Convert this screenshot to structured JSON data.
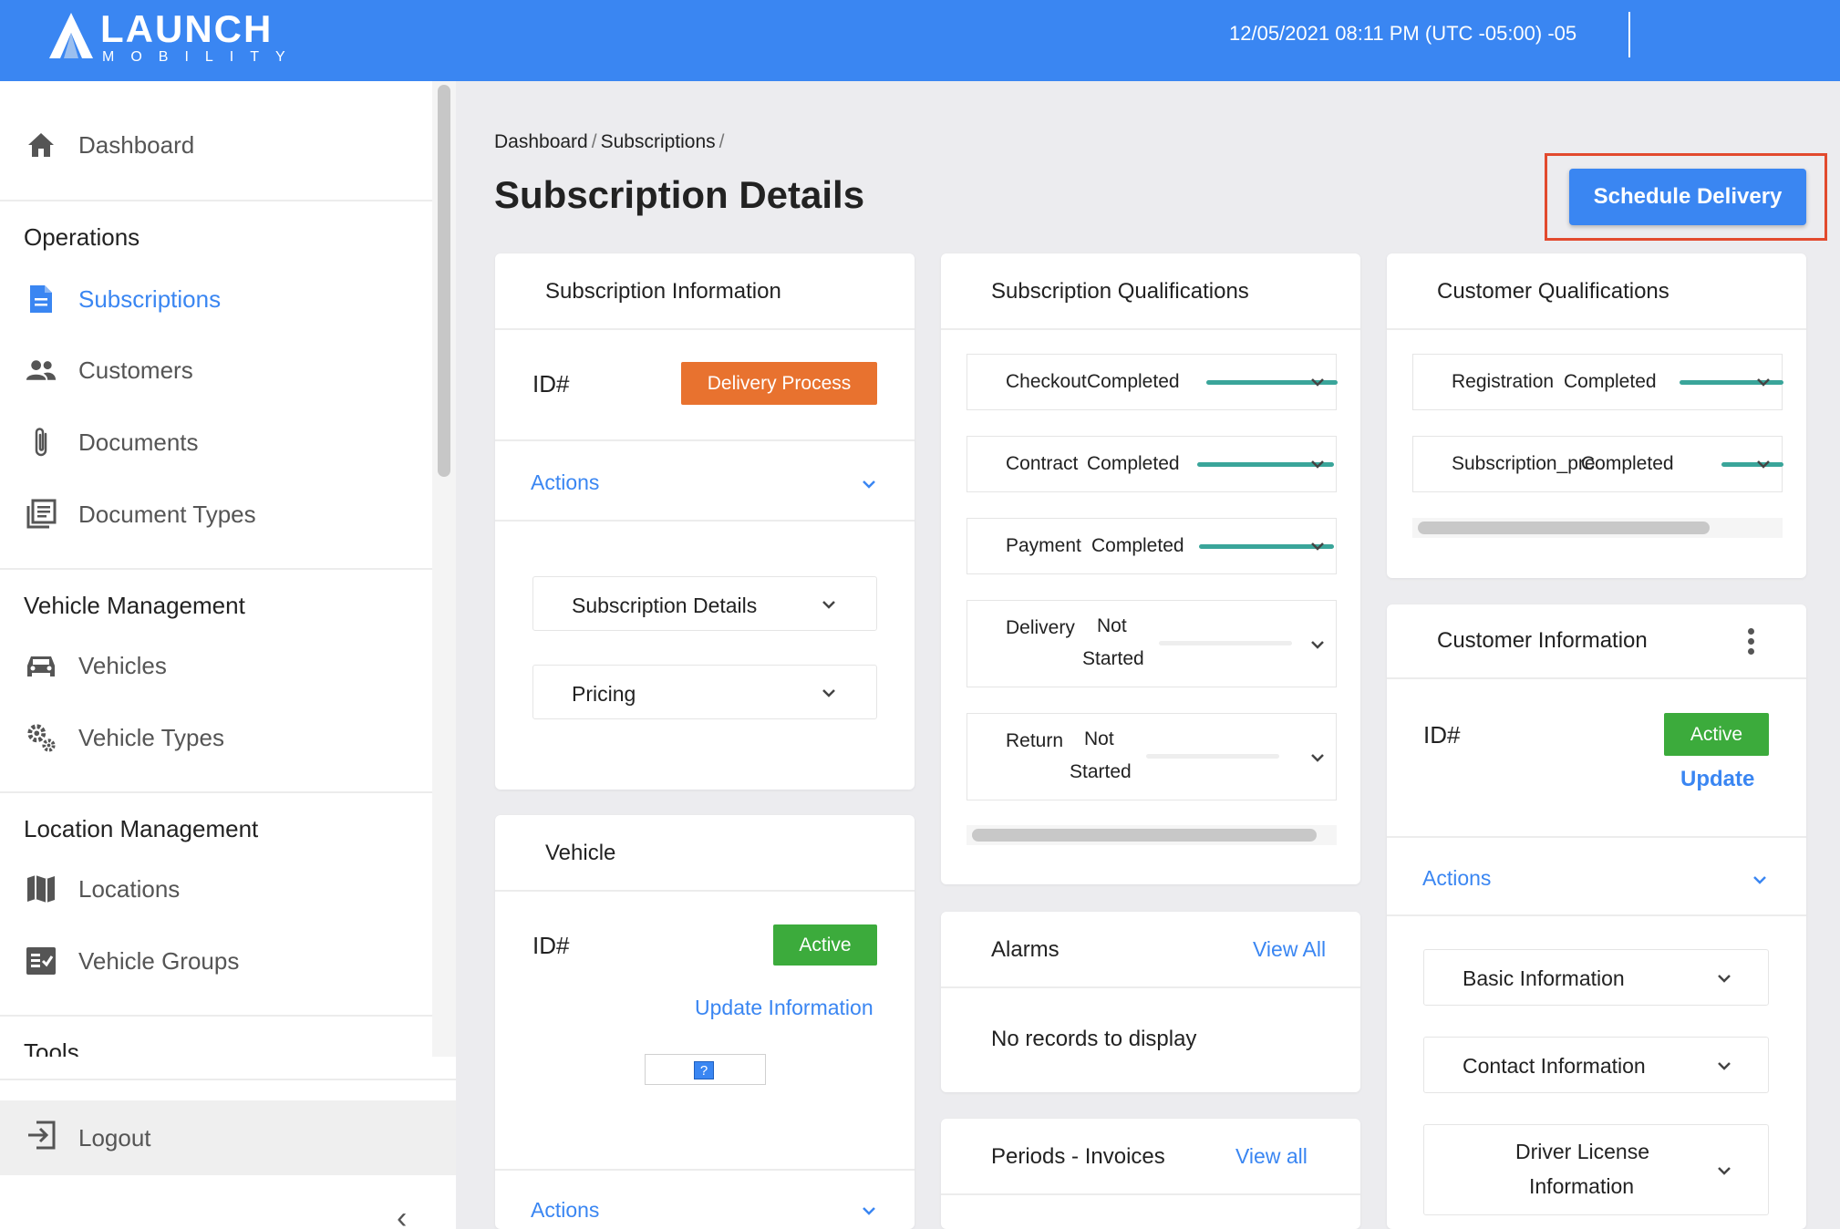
{
  "header": {
    "logo_word": "LAUNCH",
    "logo_sub": "MOBILITY",
    "datetime": "12/05/2021 08:11 PM (UTC -05:00) -05"
  },
  "sidebar": {
    "dashboard": "Dashboard",
    "sections": {
      "operations": "Operations",
      "vehicle_management": "Vehicle Management",
      "location_management": "Location Management",
      "tools": "Tools"
    },
    "items": {
      "subscriptions": "Subscriptions",
      "customers": "Customers",
      "documents": "Documents",
      "document_types": "Document Types",
      "vehicles": "Vehicles",
      "vehicle_types": "Vehicle Types",
      "locations": "Locations",
      "vehicle_groups": "Vehicle Groups"
    },
    "logout": "Logout",
    "active_color": "#3a86f2"
  },
  "breadcrumb": [
    "Dashboard",
    "Subscriptions"
  ],
  "page_title": "Subscription Details",
  "schedule_button": "Schedule Delivery",
  "subscription_info": {
    "title": "Subscription Information",
    "id_label": "ID#",
    "status_badge": "Delivery Process",
    "actions": "Actions",
    "panels": [
      "Subscription Details",
      "Pricing"
    ]
  },
  "vehicle": {
    "title": "Vehicle",
    "id_label": "ID#",
    "status_badge": "Active",
    "update_link": "Update Information",
    "image_placeholder": "?",
    "actions": "Actions"
  },
  "subscription_qualifications": {
    "title": "Subscription Qualifications",
    "rows": [
      {
        "name": "Checkout",
        "status": "Completed"
      },
      {
        "name": "Contract",
        "status": "Completed"
      },
      {
        "name": "Payment",
        "status": "Completed"
      },
      {
        "name": "Delivery",
        "status_line1": "Not",
        "status_line2": "Started"
      },
      {
        "name": "Return",
        "status_line1": "Not",
        "status_line2": "Started"
      }
    ],
    "complete_color": "#3aa59a"
  },
  "alarms": {
    "title": "Alarms",
    "view_all": "View All",
    "empty": "No records to display"
  },
  "periods": {
    "title": "Periods - Invoices",
    "view_all": "View all"
  },
  "customer_qualifications": {
    "title": "Customer Qualifications",
    "rows": [
      {
        "name": "Registration",
        "status": "Completed"
      },
      {
        "name": "Subscription_pre",
        "status": "Completed"
      }
    ]
  },
  "customer_info": {
    "title": "Customer Information",
    "id_label": "ID#",
    "status_badge": "Active",
    "update_link": "Update",
    "actions": "Actions",
    "panels": [
      "Basic Information",
      "Contact Information"
    ],
    "driver_license_line1": "Driver License",
    "driver_license_line2": "Information"
  }
}
